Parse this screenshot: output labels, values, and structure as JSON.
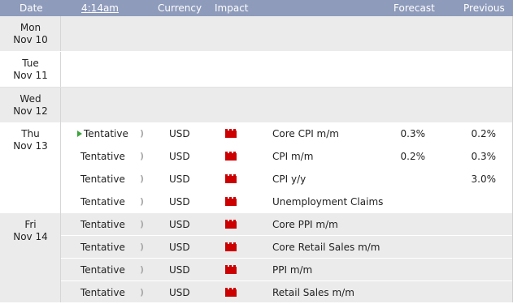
{
  "header": {
    "date": "Date",
    "time": "4:14am",
    "currency": "Currency",
    "impact": "Impact",
    "forecast": "Forecast",
    "previous": "Previous"
  },
  "colors": {
    "header_bg": "#8e9bbb",
    "row_alt": "#ebebeb",
    "impact_high": "#cc0000",
    "play": "#3da53d"
  },
  "days": [
    {
      "dow": "Mon",
      "date": "Nov 10",
      "events": []
    },
    {
      "dow": "Tue",
      "date": "Nov 11",
      "events": []
    },
    {
      "dow": "Wed",
      "date": "Nov 12",
      "events": []
    },
    {
      "dow": "Thu",
      "date": "Nov 13",
      "events": [
        {
          "time": "Tentative",
          "currency": "USD",
          "impact": "high-impact-icon",
          "name": "Core CPI m/m",
          "forecast": "0.3%",
          "previous": "0.2%"
        },
        {
          "time": "Tentative",
          "currency": "USD",
          "impact": "high-impact-icon",
          "name": "CPI m/m",
          "forecast": "0.2%",
          "previous": "0.3%"
        },
        {
          "time": "Tentative",
          "currency": "USD",
          "impact": "high-impact-icon",
          "name": "CPI y/y",
          "forecast": "",
          "previous": "3.0%"
        },
        {
          "time": "Tentative",
          "currency": "USD",
          "impact": "high-impact-icon",
          "name": "Unemployment Claims",
          "forecast": "",
          "previous": ""
        }
      ]
    },
    {
      "dow": "Fri",
      "date": "Nov 14",
      "events": [
        {
          "time": "Tentative",
          "currency": "USD",
          "impact": "high-impact-icon",
          "name": "Core PPI m/m",
          "forecast": "",
          "previous": ""
        },
        {
          "time": "Tentative",
          "currency": "USD",
          "impact": "high-impact-icon",
          "name": "Core Retail Sales m/m",
          "forecast": "",
          "previous": ""
        },
        {
          "time": "Tentative",
          "currency": "USD",
          "impact": "high-impact-icon",
          "name": "PPI m/m",
          "forecast": "",
          "previous": ""
        },
        {
          "time": "Tentative",
          "currency": "USD",
          "impact": "high-impact-icon",
          "name": "Retail Sales m/m",
          "forecast": "",
          "previous": ""
        }
      ]
    }
  ]
}
